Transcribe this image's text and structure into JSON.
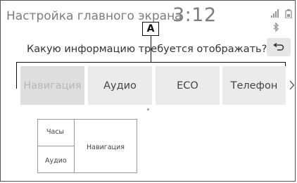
{
  "header": {
    "title": "Настройка главного экрана",
    "clock": "3:12"
  },
  "callout": {
    "label": "A"
  },
  "prompt": {
    "question": "Какую информацию требуется отображать?"
  },
  "tabs": [
    {
      "label": "Навигация",
      "selected": true
    },
    {
      "label": "Аудио",
      "selected": false
    },
    {
      "label": "ECO",
      "selected": false
    },
    {
      "label": "Телефон",
      "selected": false
    }
  ],
  "preview": {
    "top_left": "Часы",
    "bottom_left": "Аудио",
    "right": "Навигация"
  },
  "icons": {
    "signal": "signal-bars-icon",
    "battery": "battery-icon",
    "bluetooth": "bluetooth-icon",
    "back": "return-arrow-icon",
    "next": "chevron-right-icon"
  },
  "colors": {
    "header_text": "#7d7d7d",
    "tab_bg": "#ebebeb",
    "tab_selected_text": "#b6b6b6"
  }
}
